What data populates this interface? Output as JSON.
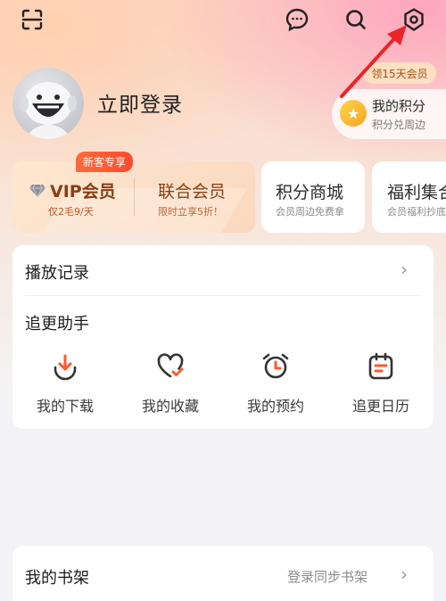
{
  "topbar": {
    "scan_icon": "scan-icon",
    "message_icon": "message-icon",
    "search_icon": "search-icon",
    "settings_icon": "settings-icon"
  },
  "profile": {
    "login_label": "立即登录"
  },
  "points": {
    "tag": "领15天会员",
    "title": "我的积分",
    "subtitle": "积分兑周边"
  },
  "vip": {
    "badge": "新客专享",
    "title": "VIP会员",
    "subtitle": "仅2毛9/天",
    "union_title": "联合会员",
    "union_subtitle": "限时立享5折！"
  },
  "mall": {
    "title": "积分商城",
    "subtitle": "会员周边免费拿"
  },
  "welfare": {
    "title": "福利集合",
    "subtitle": "会员福利抄底"
  },
  "history": {
    "label": "播放记录"
  },
  "assistant": {
    "title": "追更助手",
    "items": [
      {
        "label": "我的下载",
        "icon": "download-icon"
      },
      {
        "label": "我的收藏",
        "icon": "favorite-icon"
      },
      {
        "label": "我的预约",
        "icon": "alarm-icon"
      },
      {
        "label": "追更日历",
        "icon": "calendar-icon"
      }
    ]
  },
  "bookshelf": {
    "title": "我的书架",
    "action": "登录同步书架"
  },
  "colors": {
    "accent": "#ff5a2a",
    "vip_text": "#8a3e12",
    "annotation": "#e8262a"
  }
}
